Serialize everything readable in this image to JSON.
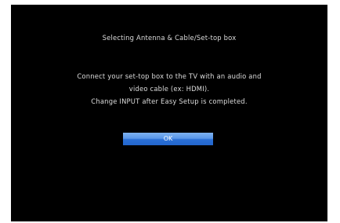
{
  "dialog": {
    "title": "Selecting Antenna & Cable/Set-top box",
    "message_lines": [
      "Connect your set-top box to the TV with an audio and",
      "video cable (ex: HDMI).",
      "Change INPUT after Easy Setup is completed."
    ],
    "ok_label": "OK"
  },
  "colors": {
    "background": "#000000",
    "text": "#dcdcdc",
    "button_accent": "#2a6fd6"
  }
}
